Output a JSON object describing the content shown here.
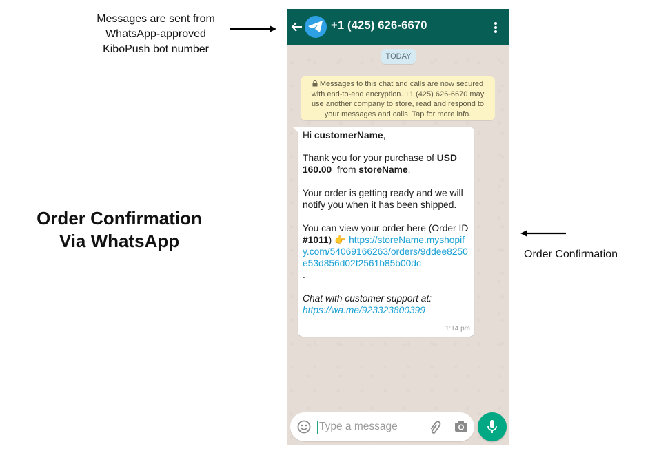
{
  "annotations": {
    "top_lines": [
      "Messages are sent from",
      "WhatsApp-approved",
      "KiboPush bot number"
    ],
    "title_lines": [
      "Order Confirmation",
      "Via WhatsApp"
    ],
    "right_label": "Order Confirmation"
  },
  "chat": {
    "contact": "+1 (425) 626-6670",
    "date_chip": "TODAY",
    "encryption_notice": "Messages to this chat and calls are now secured with end-to-end encryption. +1 (425) 626-6670 may use another company to store, read and respond to your messages and calls. Tap for more info.",
    "message": {
      "greeting_prefix": "Hi ",
      "customer_name": "customerName",
      "greeting_suffix": ",",
      "thanks_prefix": "Thank you for your purchase of ",
      "amount": "USD 160.00",
      "thanks_mid": "  from ",
      "store_name": "storeName",
      "thanks_suffix": ".",
      "status": "Your order is getting ready and we will notify you when it has been shipped.",
      "view_prefix": "You can view your order here (Order ID ",
      "order_id": "#1011",
      "view_mid": ") ",
      "pointing_emoji": "👉",
      "order_link": "https://storeName.myshopify.com/54069166263/orders/9ddee8250e53d856d02f2561b85b00dc",
      "period": ".",
      "support_label": "Chat with customer support at:",
      "support_link": "https://wa.me/923323800399",
      "time": "1:14 pm"
    },
    "input_placeholder": "Type a message",
    "icons": [
      "back-arrow-icon",
      "telegram-icon",
      "more-vert-icon",
      "lock-icon",
      "emoji-icon",
      "paperclip-icon",
      "camera-icon",
      "mic-icon"
    ],
    "colors": {
      "header": "#075e54",
      "chat_background": "#e5ddd5",
      "link": "#1ba1d4",
      "notice_background": "#fdf4c5",
      "mic_button": "#00a884"
    }
  }
}
